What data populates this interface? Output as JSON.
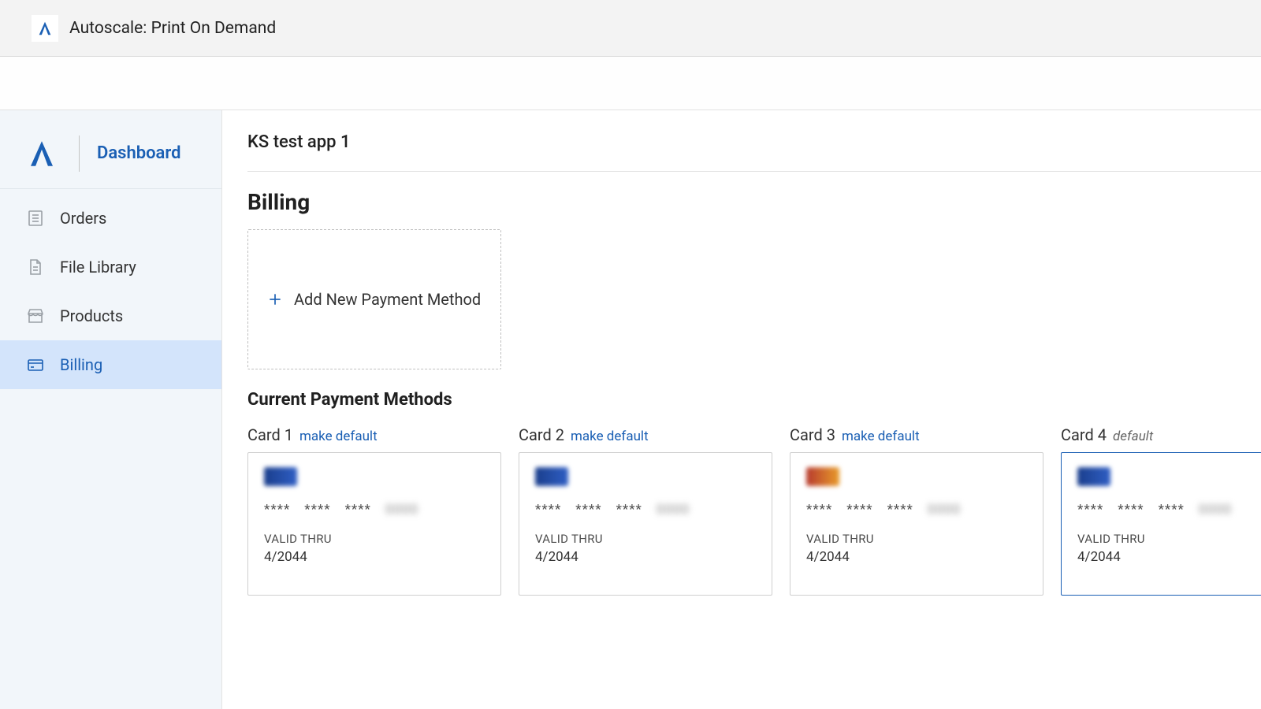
{
  "topbar": {
    "title": "Autoscale: Print On Demand"
  },
  "sidebar": {
    "dashboard_label": "Dashboard",
    "items": [
      {
        "label": "Orders",
        "icon": "list"
      },
      {
        "label": "File Library",
        "icon": "file"
      },
      {
        "label": "Products",
        "icon": "store"
      },
      {
        "label": "Billing",
        "icon": "card",
        "selected": true
      }
    ]
  },
  "main": {
    "app_title": "KS test app 1",
    "billing_heading": "Billing",
    "add_payment_label": "Add New Payment Method",
    "current_methods_heading": "Current Payment Methods",
    "make_default_label": "make default",
    "default_label": "default",
    "valid_thru_label": "VALID THRU",
    "masked_group": "****",
    "cards": [
      {
        "label": "Card 1",
        "brand": "visa",
        "last4": "0000",
        "valid_thru": "4/2044",
        "is_default": false
      },
      {
        "label": "Card 2",
        "brand": "visa",
        "last4": "0000",
        "valid_thru": "4/2044",
        "is_default": false
      },
      {
        "label": "Card 3",
        "brand": "mc",
        "last4": "0000",
        "valid_thru": "4/2044",
        "is_default": false
      },
      {
        "label": "Card 4",
        "brand": "visa",
        "last4": "0000",
        "valid_thru": "4/2044",
        "is_default": true
      }
    ]
  },
  "colors": {
    "accent": "#1a5fb4",
    "sidebar_bg": "#f2f6fa",
    "selected_bg": "#d3e4fb"
  }
}
